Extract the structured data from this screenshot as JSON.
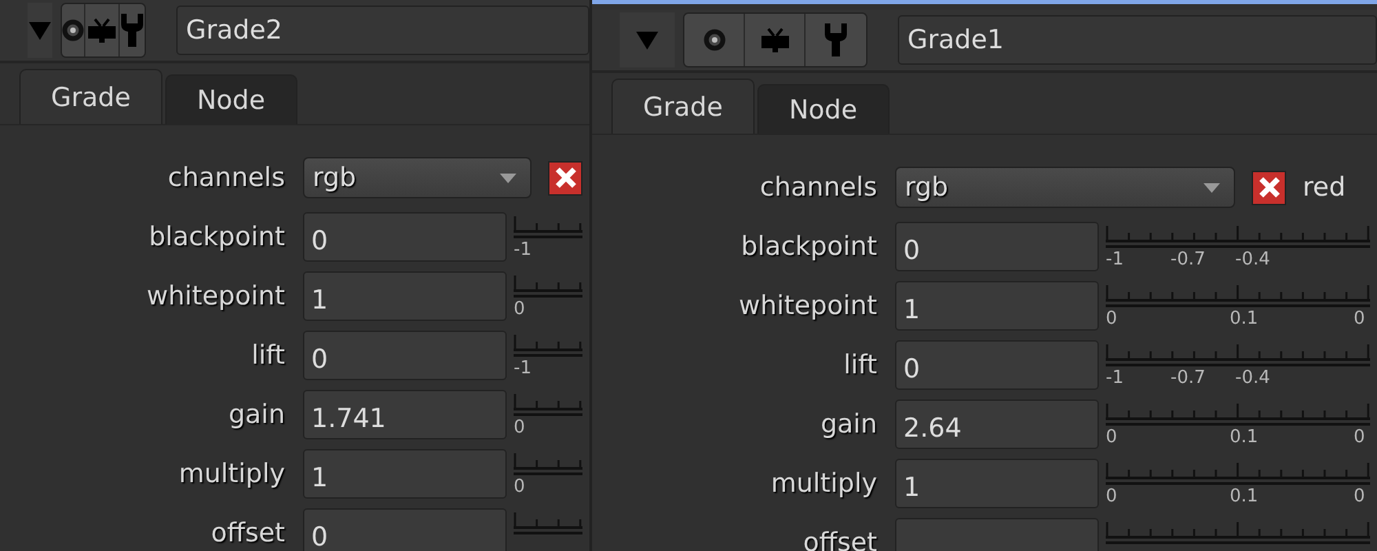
{
  "panels": [
    {
      "title": "Grade2",
      "focused": false,
      "tabs": [
        {
          "label": "Grade",
          "selected": true
        },
        {
          "label": "Node",
          "selected": false
        }
      ],
      "channels": {
        "label": "channels",
        "value": "rgb"
      },
      "rows": [
        {
          "label": "blackpoint",
          "value": "0",
          "ticks": [
            "-1"
          ]
        },
        {
          "label": "whitepoint",
          "value": "1",
          "ticks": [
            "0"
          ]
        },
        {
          "label": "lift",
          "value": "0",
          "ticks": [
            "-1"
          ]
        },
        {
          "label": "gain",
          "value": "1.741",
          "ticks": [
            "0"
          ]
        },
        {
          "label": "multiply",
          "value": "1",
          "ticks": [
            "0"
          ]
        },
        {
          "label": "offset",
          "value": "0"
        }
      ]
    },
    {
      "title": "Grade1",
      "focused": true,
      "tabs": [
        {
          "label": "Grade",
          "selected": true
        },
        {
          "label": "Node",
          "selected": false
        }
      ],
      "channels": {
        "label": "channels",
        "value": "rgb",
        "toggle_label": "red"
      },
      "rows": [
        {
          "label": "blackpoint",
          "value": "0",
          "kind": "fine",
          "ticks": [
            "-1",
            "-0.7",
            "-0.4"
          ]
        },
        {
          "label": "whitepoint",
          "value": "1",
          "kind": "wide",
          "ticks": [
            "0",
            "0.1",
            "0"
          ]
        },
        {
          "label": "lift",
          "value": "0",
          "kind": "fine",
          "ticks": [
            "-1",
            "-0.7",
            "-0.4"
          ]
        },
        {
          "label": "gain",
          "value": "2.64",
          "kind": "wide",
          "ticks": [
            "0",
            "0.1",
            "0"
          ]
        },
        {
          "label": "multiply",
          "value": "1",
          "kind": "wide",
          "ticks": [
            "0",
            "0.1",
            "0"
          ]
        },
        {
          "label": "offset"
        }
      ]
    }
  ]
}
